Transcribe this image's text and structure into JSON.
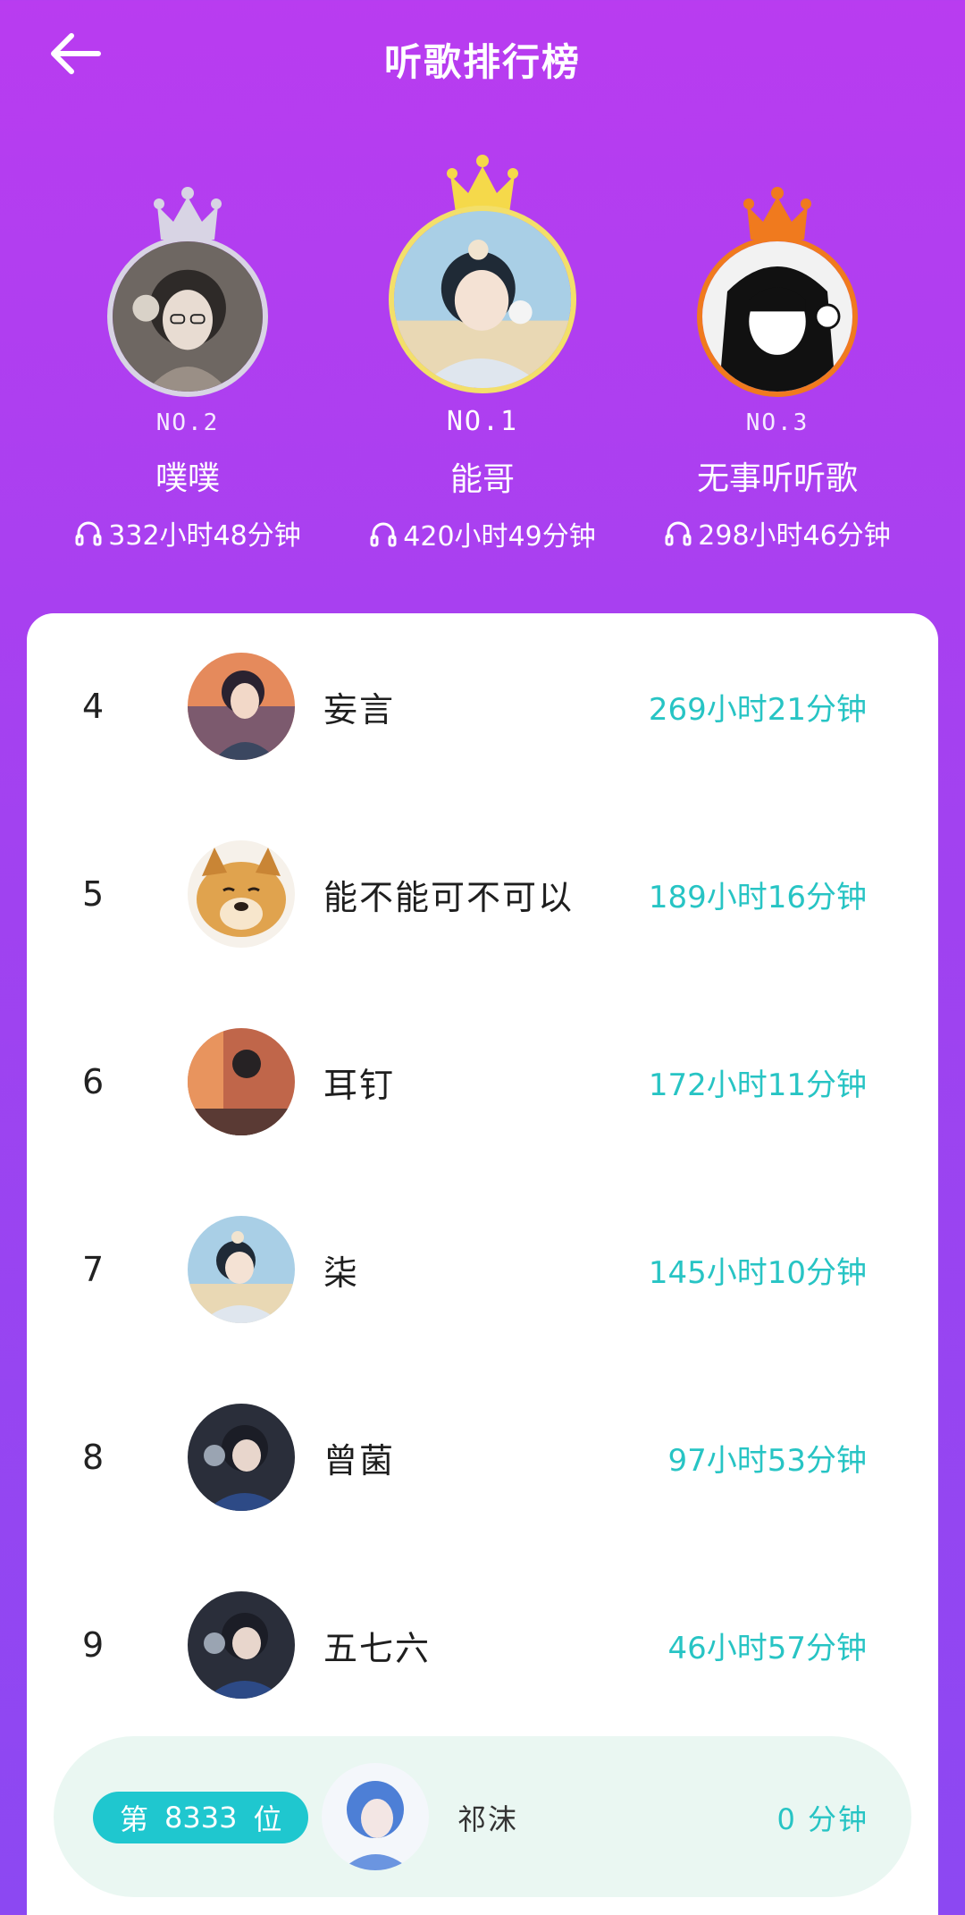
{
  "header": {
    "title": "听歌排行榜"
  },
  "podium": [
    {
      "rank_label": "NO.2",
      "name": "噗噗",
      "time": "332小时48分钟",
      "crown_color": "#d8d4e4",
      "ring_color": "#d8d4e4"
    },
    {
      "rank_label": "NO.1",
      "name": "能哥",
      "time": "420小时49分钟",
      "crown_color": "#f5d94a",
      "ring_color": "#f3df6a"
    },
    {
      "rank_label": "NO.3",
      "name": "无事听听歌",
      "time": "298小时46分钟",
      "crown_color": "#f07a1e",
      "ring_color": "#f07a1e"
    }
  ],
  "list": [
    {
      "rank": "4",
      "name": "妄言",
      "time": "269小时21分钟"
    },
    {
      "rank": "5",
      "name": "能不能可不可以",
      "time": "189小时16分钟"
    },
    {
      "rank": "6",
      "name": "耳钉",
      "time": "172小时11分钟"
    },
    {
      "rank": "7",
      "name": "柒",
      "time": "145小时10分钟"
    },
    {
      "rank": "8",
      "name": "曾菌",
      "time": "97小时53分钟"
    },
    {
      "rank": "9",
      "name": "五七六",
      "time": "46小时57分钟"
    }
  ],
  "me": {
    "rank_prefix": "第",
    "rank_number": "8333",
    "rank_suffix": "位",
    "name": "祁沫",
    "time": "0 分钟"
  },
  "colors": {
    "accent_teal": "#27c4c4",
    "badge": "#1fc7cf",
    "bg_top": "#b93cf0",
    "bg_bottom": "#8c48f2"
  }
}
